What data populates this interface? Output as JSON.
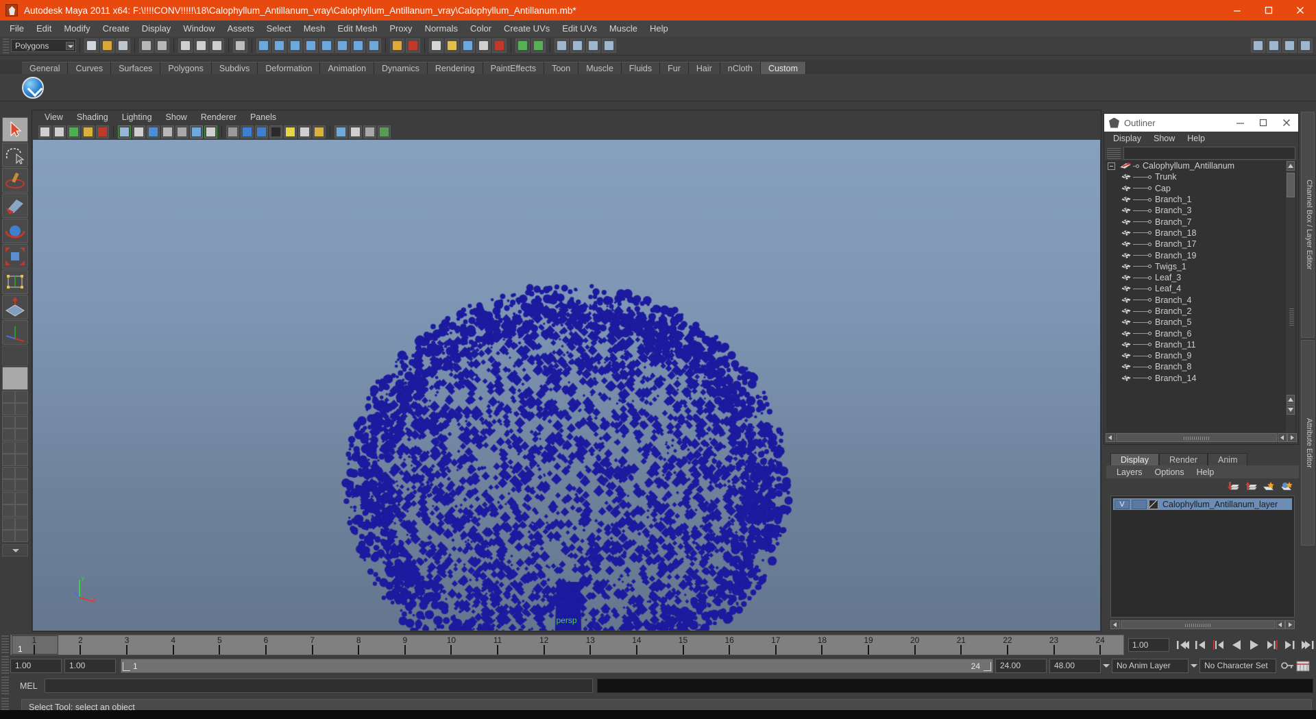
{
  "window": {
    "title": "Autodesk Maya 2011 x64: F:\\!!!!CONV!!!!!\\18\\Calophyllum_Antillanum_vray\\Calophyllum_Antillanum_vray\\Calophyllum_Antillanum.mb*",
    "titlebar_color": "#e8490f",
    "minimize_label": "─",
    "maximize_label": "☐",
    "close_label": "✕"
  },
  "menubar": {
    "items": [
      {
        "label": "File"
      },
      {
        "label": "Edit"
      },
      {
        "label": "Modify"
      },
      {
        "label": "Create"
      },
      {
        "label": "Display"
      },
      {
        "label": "Window"
      },
      {
        "label": "Assets"
      },
      {
        "label": "Select"
      },
      {
        "label": "Mesh"
      },
      {
        "label": "Edit Mesh"
      },
      {
        "label": "Proxy"
      },
      {
        "label": "Normals"
      },
      {
        "label": "Color"
      },
      {
        "label": "Create UVs"
      },
      {
        "label": "Edit UVs"
      },
      {
        "label": "Muscle"
      },
      {
        "label": "Help"
      }
    ]
  },
  "statusline": {
    "mode_selector_value": "Polygons"
  },
  "shelf": {
    "tabs": [
      {
        "label": "General",
        "active": false
      },
      {
        "label": "Curves",
        "active": false
      },
      {
        "label": "Surfaces",
        "active": false
      },
      {
        "label": "Polygons",
        "active": false
      },
      {
        "label": "Subdivs",
        "active": false
      },
      {
        "label": "Deformation",
        "active": false
      },
      {
        "label": "Animation",
        "active": false
      },
      {
        "label": "Dynamics",
        "active": false
      },
      {
        "label": "Rendering",
        "active": false
      },
      {
        "label": "PaintEffects",
        "active": false
      },
      {
        "label": "Toon",
        "active": false
      },
      {
        "label": "Muscle",
        "active": false
      },
      {
        "label": "Fluids",
        "active": false
      },
      {
        "label": "Fur",
        "active": false
      },
      {
        "label": "Hair",
        "active": false
      },
      {
        "label": "nCloth",
        "active": false
      },
      {
        "label": "Custom",
        "active": true
      }
    ]
  },
  "viewport": {
    "menu": [
      {
        "label": "View"
      },
      {
        "label": "Shading"
      },
      {
        "label": "Lighting"
      },
      {
        "label": "Show"
      },
      {
        "label": "Renderer"
      },
      {
        "label": "Panels"
      }
    ],
    "camera_label": "persp",
    "camera_label_color": "#59c759",
    "model_color": "#1c1a9e",
    "background_top": "#87a0bd",
    "background_bottom": "#64778f",
    "axis_labels": {
      "y": "y",
      "x": "x"
    }
  },
  "outliner": {
    "title": "Outliner",
    "menu": [
      {
        "label": "Display"
      },
      {
        "label": "Show"
      },
      {
        "label": "Help"
      }
    ],
    "search_value": "",
    "root": {
      "label": "Calophyllum_Antillanum"
    },
    "items": [
      {
        "label": "Trunk"
      },
      {
        "label": "Cap"
      },
      {
        "label": "Branch_1"
      },
      {
        "label": "Branch_3"
      },
      {
        "label": "Branch_7"
      },
      {
        "label": "Branch_18"
      },
      {
        "label": "Branch_17"
      },
      {
        "label": "Branch_19"
      },
      {
        "label": "Twigs_1"
      },
      {
        "label": "Leaf_3"
      },
      {
        "label": "Leaf_4"
      },
      {
        "label": "Branch_4"
      },
      {
        "label": "Branch_2"
      },
      {
        "label": "Branch_5"
      },
      {
        "label": "Branch_6"
      },
      {
        "label": "Branch_11"
      },
      {
        "label": "Branch_9"
      },
      {
        "label": "Branch_8"
      },
      {
        "label": "Branch_14"
      }
    ]
  },
  "layer_editor": {
    "tabs": [
      {
        "label": "Display",
        "active": true
      },
      {
        "label": "Render",
        "active": false
      },
      {
        "label": "Anim",
        "active": false
      }
    ],
    "menu": [
      {
        "label": "Layers"
      },
      {
        "label": "Options"
      },
      {
        "label": "Help"
      }
    ],
    "layers": [
      {
        "visibility": "V",
        "playback": "",
        "name": "Calophyllum_Antillanum_layer",
        "selected": true
      }
    ]
  },
  "right_dock": {
    "tabs": [
      {
        "label": "Channel Box / Layer Editor"
      },
      {
        "label": "Attribute Editor"
      }
    ]
  },
  "time_slider": {
    "ticks": [
      1,
      2,
      3,
      4,
      5,
      6,
      7,
      8,
      9,
      10,
      11,
      12,
      13,
      14,
      15,
      16,
      17,
      18,
      19,
      20,
      21,
      22,
      23,
      24
    ],
    "current_frame": "1",
    "current_frame_field": "1.00",
    "playback_buttons": [
      "go-to-start",
      "step-back-keyframe",
      "step-back-frame",
      "play-backwards",
      "play-forwards",
      "step-forward-frame",
      "step-forward-keyframe",
      "go-to-end"
    ]
  },
  "range_slider": {
    "start_field": "1.00",
    "range_start_field": "1.00",
    "range_bar_left": "1",
    "range_bar_right": "24",
    "range_end_field": "24.00",
    "end_field": "48.00",
    "anim_layer": "No Anim Layer",
    "character_set": "No Character Set"
  },
  "command_line": {
    "label": "MEL",
    "input_value": "",
    "output_value": ""
  },
  "help_line": {
    "text": "Select Tool: select an object"
  }
}
